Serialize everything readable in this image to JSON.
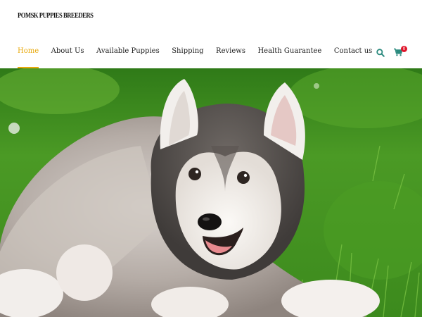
{
  "site": {
    "logo": "POMSK PUPPIES BREEDERS"
  },
  "nav": {
    "items": [
      {
        "label": "Home",
        "active": true
      },
      {
        "label": "About Us"
      },
      {
        "label": "Available Puppies"
      },
      {
        "label": "Shipping"
      },
      {
        "label": "Reviews"
      },
      {
        "label": "Health Guarantee"
      },
      {
        "label": "Contact us"
      }
    ],
    "icons": {
      "search": "search-icon",
      "cart": "cart-icon"
    },
    "cart_count": "0"
  },
  "colors": {
    "accent": "#e8a90c",
    "icon": "#2b8a7e",
    "badge": "#e0162b",
    "grass": "#3f8f1f"
  },
  "hero": {
    "subject": "husky-puppy-on-grass"
  }
}
